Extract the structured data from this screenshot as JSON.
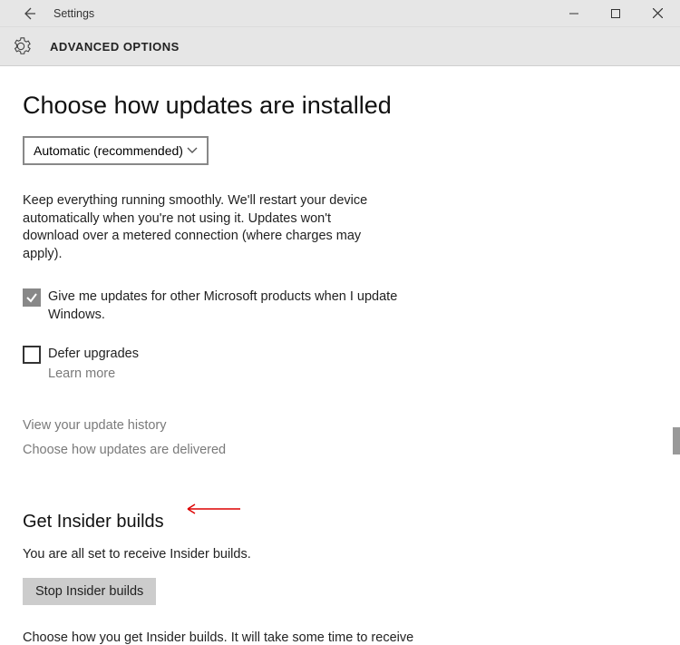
{
  "titlebar": {
    "title": "Settings"
  },
  "header": {
    "title": "ADVANCED OPTIONS"
  },
  "main": {
    "heading": "Choose how updates are installed",
    "dropdown_value": "Automatic (recommended)",
    "description": "Keep everything running smoothly. We'll restart your device automatically when you're not using it. Updates won't download over a metered connection (where charges may apply).",
    "checkbox1_label": "Give me updates for other Microsoft products when I update Windows.",
    "checkbox1_checked": true,
    "checkbox2_label": "Defer upgrades",
    "checkbox2_checked": false,
    "learn_more": "Learn more",
    "history_link": "View your update history",
    "delivery_link": "Choose how updates are delivered"
  },
  "insider": {
    "heading": "Get Insider builds",
    "status": "You are all set to receive Insider builds.",
    "button": "Stop Insider builds",
    "footer": "Choose how you get Insider builds. It will take some time to receive"
  }
}
